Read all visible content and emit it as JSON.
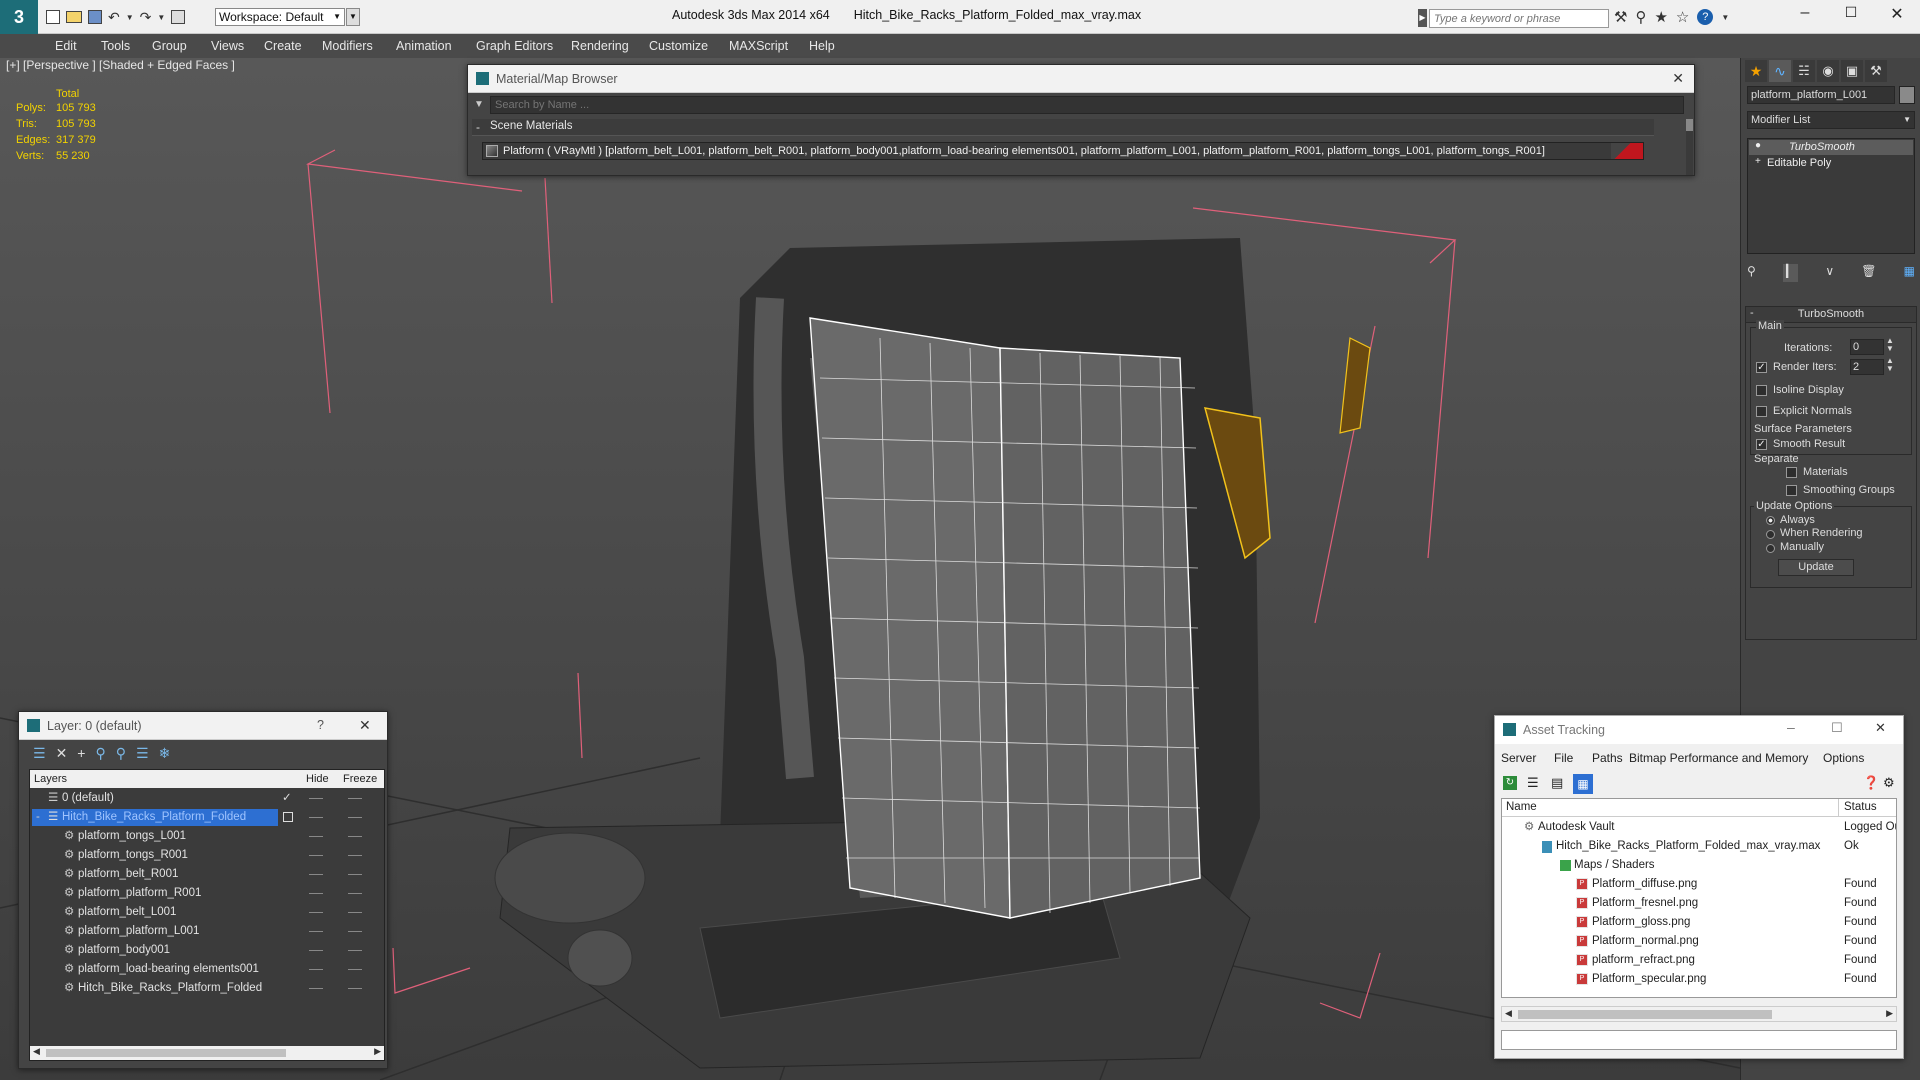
{
  "app": {
    "title": "Autodesk 3ds Max  2014 x64",
    "file": "Hitch_Bike_Racks_Platform_Folded_max_vray.max",
    "workspace": "Workspace: Default",
    "search_placeholder": "Type a keyword or phrase"
  },
  "menu": [
    "Edit",
    "Tools",
    "Group",
    "Views",
    "Create",
    "Modifiers",
    "Animation",
    "Graph Editors",
    "Rendering",
    "Customize",
    "MAXScript",
    "Help"
  ],
  "viewport": {
    "label": "[+] [Perspective ] [Shaded + Edged Faces ]",
    "stats": {
      "header": "Total",
      "rows": [
        {
          "label": "Polys:",
          "value": "105 793"
        },
        {
          "label": "Tris:",
          "value": "105 793"
        },
        {
          "label": "Edges:",
          "value": "317 379"
        },
        {
          "label": "Verts:",
          "value": "55 230"
        }
      ]
    }
  },
  "material_browser": {
    "title": "Material/Map Browser",
    "search_placeholder": "Search by Name ...",
    "section": "Scene Materials",
    "section_toggle": "-",
    "item": "Platform ( VRayMtl ) [platform_belt_L001, platform_belt_R001, platform_body001,platform_load-bearing elements001, platform_platform_L001, platform_platform_R001, platform_tongs_L001, platform_tongs_R001]"
  },
  "command_panel": {
    "object_name": "platform_platform_L001",
    "modifier_list": "Modifier List",
    "stack": [
      "TurboSmooth",
      "Editable Poly"
    ],
    "rollout_title": "TurboSmooth",
    "main_group": "Main",
    "iterations_label": "Iterations:",
    "iterations_value": "0",
    "render_iters_label": "Render Iters:",
    "render_iters_value": "2",
    "isoline": "Isoline Display",
    "explicit_normals": "Explicit Normals",
    "surface_params": "Surface Parameters",
    "smooth_result": "Smooth Result",
    "separate": "Separate",
    "materials": "Materials",
    "smoothing_groups": "Smoothing Groups",
    "update_options": "Update Options",
    "always": "Always",
    "when_rendering": "When Rendering",
    "manually": "Manually",
    "update_button": "Update"
  },
  "layer_panel": {
    "title": "Layer: 0 (default)",
    "help": "?",
    "col_layers": "Layers",
    "col_hide": "Hide",
    "col_freeze": "Freeze",
    "rows": [
      "0 (default)",
      "Hitch_Bike_Racks_Platform_Folded",
      "platform_tongs_L001",
      "platform_tongs_R001",
      "platform_belt_R001",
      "platform_platform_R001",
      "platform_belt_L001",
      "platform_platform_L001",
      "platform_body001",
      "platform_load-bearing elements001",
      "Hitch_Bike_Racks_Platform_Folded"
    ]
  },
  "asset_tracking": {
    "title": "Asset Tracking",
    "menu": [
      "Server",
      "File",
      "Paths",
      "Bitmap Performance and Memory",
      "Options"
    ],
    "col_name": "Name",
    "col_status": "Status",
    "rows": [
      {
        "name": "Autodesk Vault",
        "status": "Logged Ou"
      },
      {
        "name": "Hitch_Bike_Racks_Platform_Folded_max_vray.max",
        "status": "Ok"
      },
      {
        "name": "Maps / Shaders",
        "status": ""
      },
      {
        "name": "Platform_diffuse.png",
        "status": "Found"
      },
      {
        "name": "Platform_fresnel.png",
        "status": "Found"
      },
      {
        "name": "Platform_gloss.png",
        "status": "Found"
      },
      {
        "name": "Platform_normal.png",
        "status": "Found"
      },
      {
        "name": "platform_refract.png",
        "status": "Found"
      },
      {
        "name": "Platform_specular.png",
        "status": "Found"
      }
    ]
  },
  "colors": {
    "selection": "#2d6fd2",
    "stat_yellow": "#f2d200",
    "bbox_pink": "#e0607a",
    "ui_dark": "#444444"
  }
}
